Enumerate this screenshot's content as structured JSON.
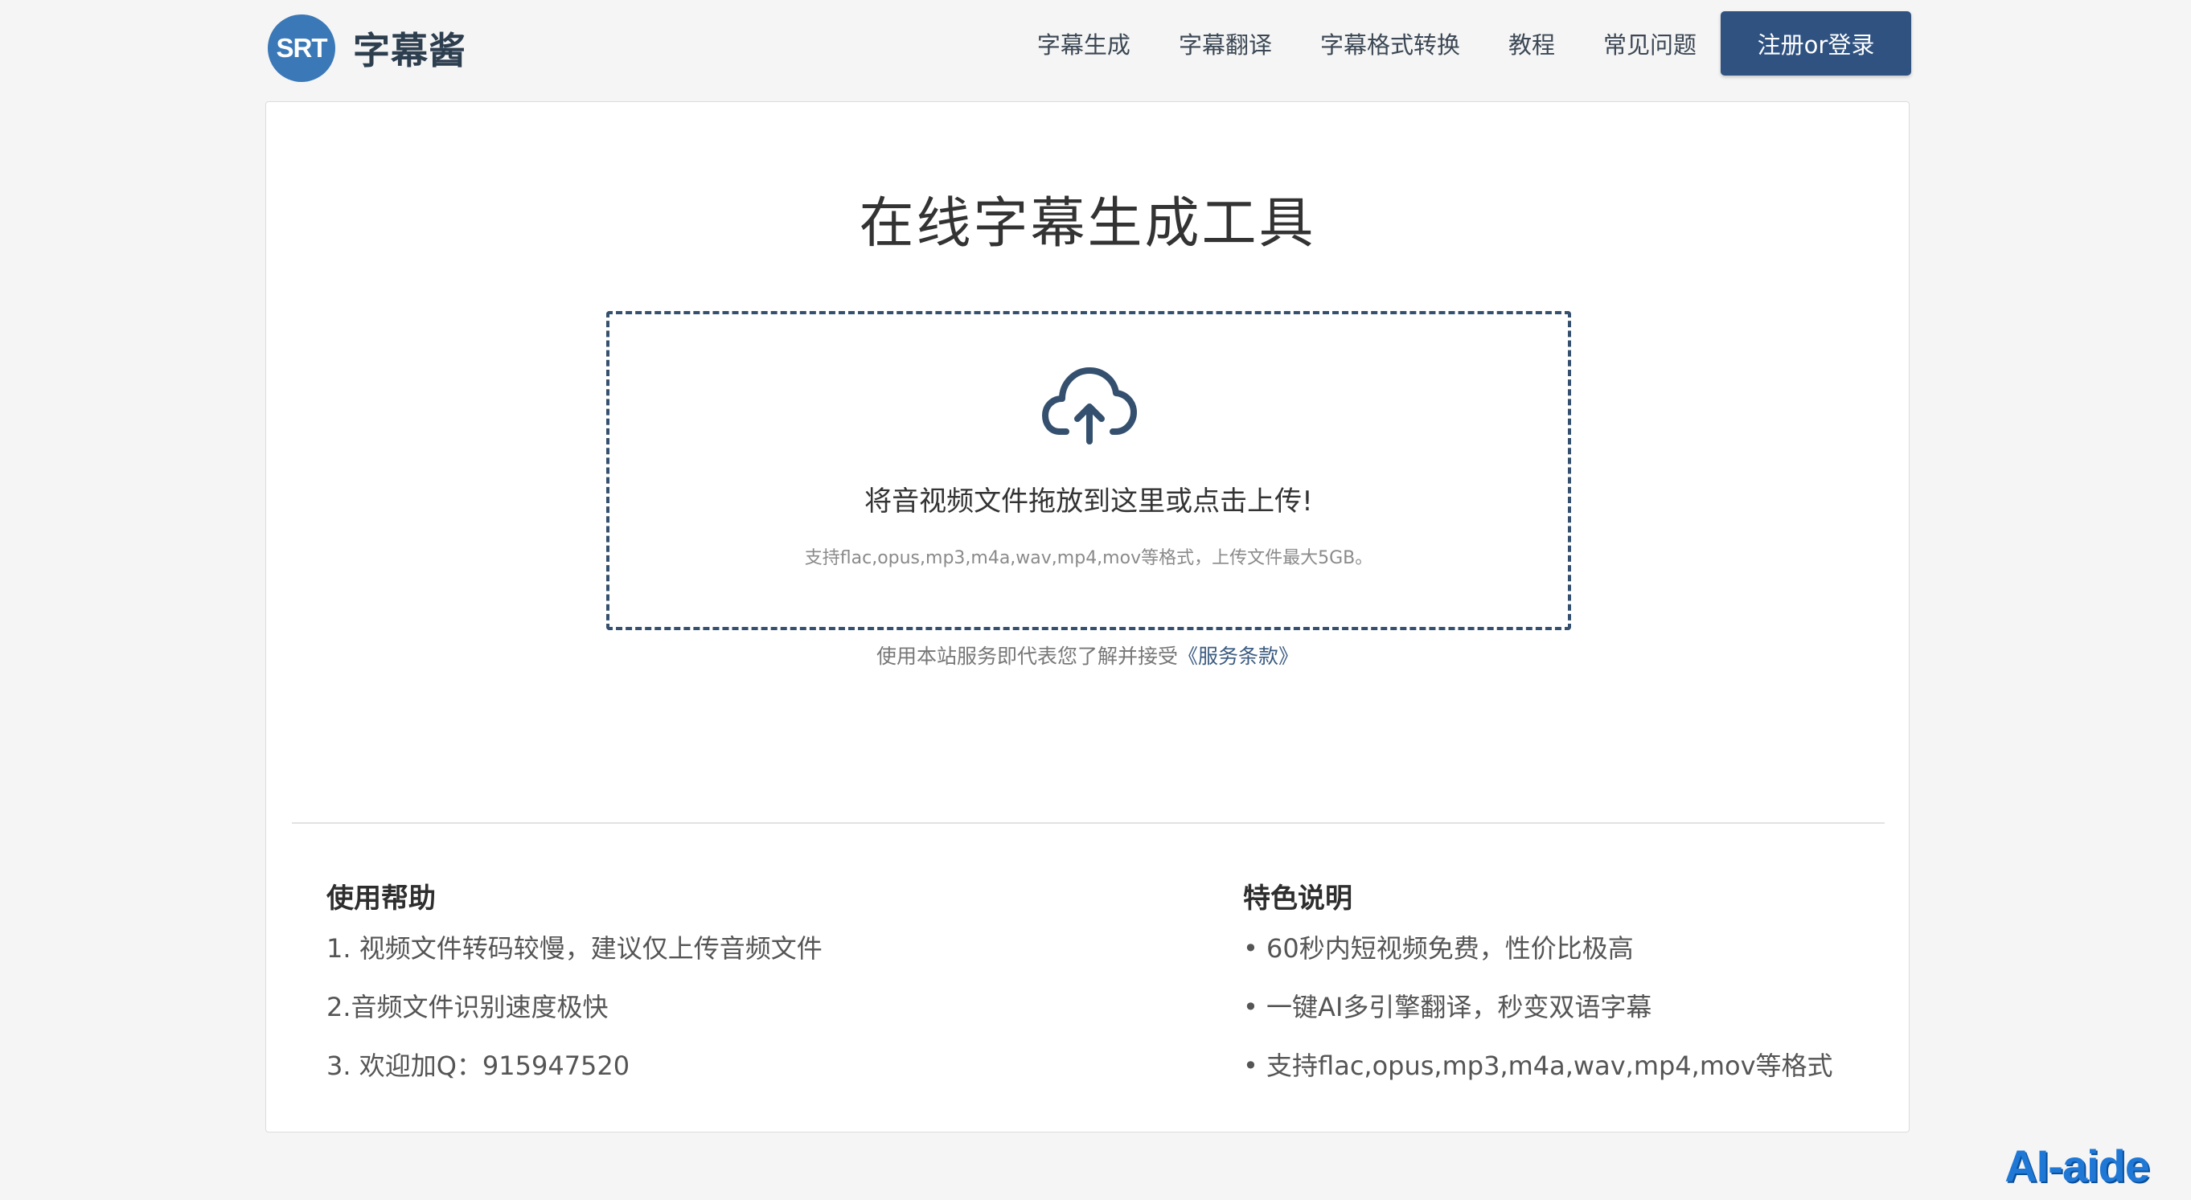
{
  "header": {
    "logo_badge": "SRT",
    "logo_name": "字幕酱",
    "nav": [
      "字幕生成",
      "字幕翻译",
      "字幕格式转换",
      "教程",
      "常见问题"
    ],
    "login_label": "注册or登录"
  },
  "main": {
    "title": "在线字幕生成工具",
    "upload": {
      "icon": "cloud-upload-icon",
      "prompt": "将音视频文件拖放到这里或点击上传!",
      "formats_note": "支持flac,opus,mp3,m4a,wav,mp4,mov等格式，上传文件最大5GB。"
    },
    "terms_prefix": "使用本站服务即代表您了解并接受",
    "terms_link": "《服务条款》"
  },
  "help": {
    "title": "使用帮助",
    "items": [
      "1. 视频文件转码较慢，建议仅上传音频文件",
      "2.音频文件识别速度极快",
      "3. 欢迎加Q：915947520"
    ]
  },
  "features": {
    "title": "特色说明",
    "items": [
      "• 60秒内短视频免费，性价比极高",
      "• 一键AI多引擎翻译，秒变双语字幕",
      "• 支持flac,opus,mp3,m4a,wav,mp4,mov等格式"
    ]
  },
  "watermark": "AI-aide",
  "colors": {
    "brand": "#3a78b7",
    "button": "#2f5280",
    "dropzone_border": "#34506e"
  }
}
